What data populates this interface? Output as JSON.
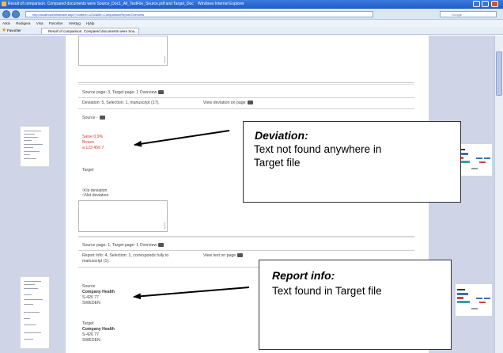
{
  "window": {
    "title": "Result of comparison. Compared documents were Source_Doc1_All_TestFile_Source.pdf and Target_Doc",
    "browser": "Windows Internet Explorer"
  },
  "address": {
    "url": "http://localhost/inlinesafe.aspx?context=1234&file=ComparisonReport/Overview",
    "search_placeholder": "Google"
  },
  "menubar": {
    "items": [
      "Arkiv",
      "Redigera",
      "Visa",
      "Favoriter",
      "Verktyg",
      "Hjälp"
    ]
  },
  "favorites": {
    "label": "Favoriter",
    "tab": "Result of comparison. Compared documents were Sou..."
  },
  "block1": {
    "source_line": "Source page: 3, Target page: 1 Overview",
    "deviation_line": "Deviation: 5, Selection: 1, manuscript (17).",
    "view_link": "View deviation on page",
    "source_label": "Source -",
    "source_values": [
      "Salve 0,9%",
      "Brown",
      "a 123 456 7"
    ],
    "target_label": "Target",
    "radio_is": "Is deviation",
    "radio_not": "Not deviation"
  },
  "block2": {
    "source_line": "Source page: 1, Target page: 1 Overview",
    "report_line1": "Report Info: 4, Selection: 1, corresponds fully to",
    "report_line2": "manuscript (1).",
    "view_link": "View text on page",
    "source_label": "Source",
    "source_values": [
      "Company Health",
      "S-426 77",
      "SWEDEN"
    ],
    "target_label": "Target",
    "target_values": [
      "Company Health",
      "S-426 77",
      "SWEDEN"
    ]
  },
  "callout_deviation": {
    "title": "Deviation:",
    "text_line1": "Text not found anywhere in",
    "text_line2": "Target file"
  },
  "callout_report": {
    "title": "Report info:",
    "text": "Text found in Target file"
  },
  "colors": {
    "deviation_text": "#dd3333",
    "page_background": "#cfd4e6"
  }
}
